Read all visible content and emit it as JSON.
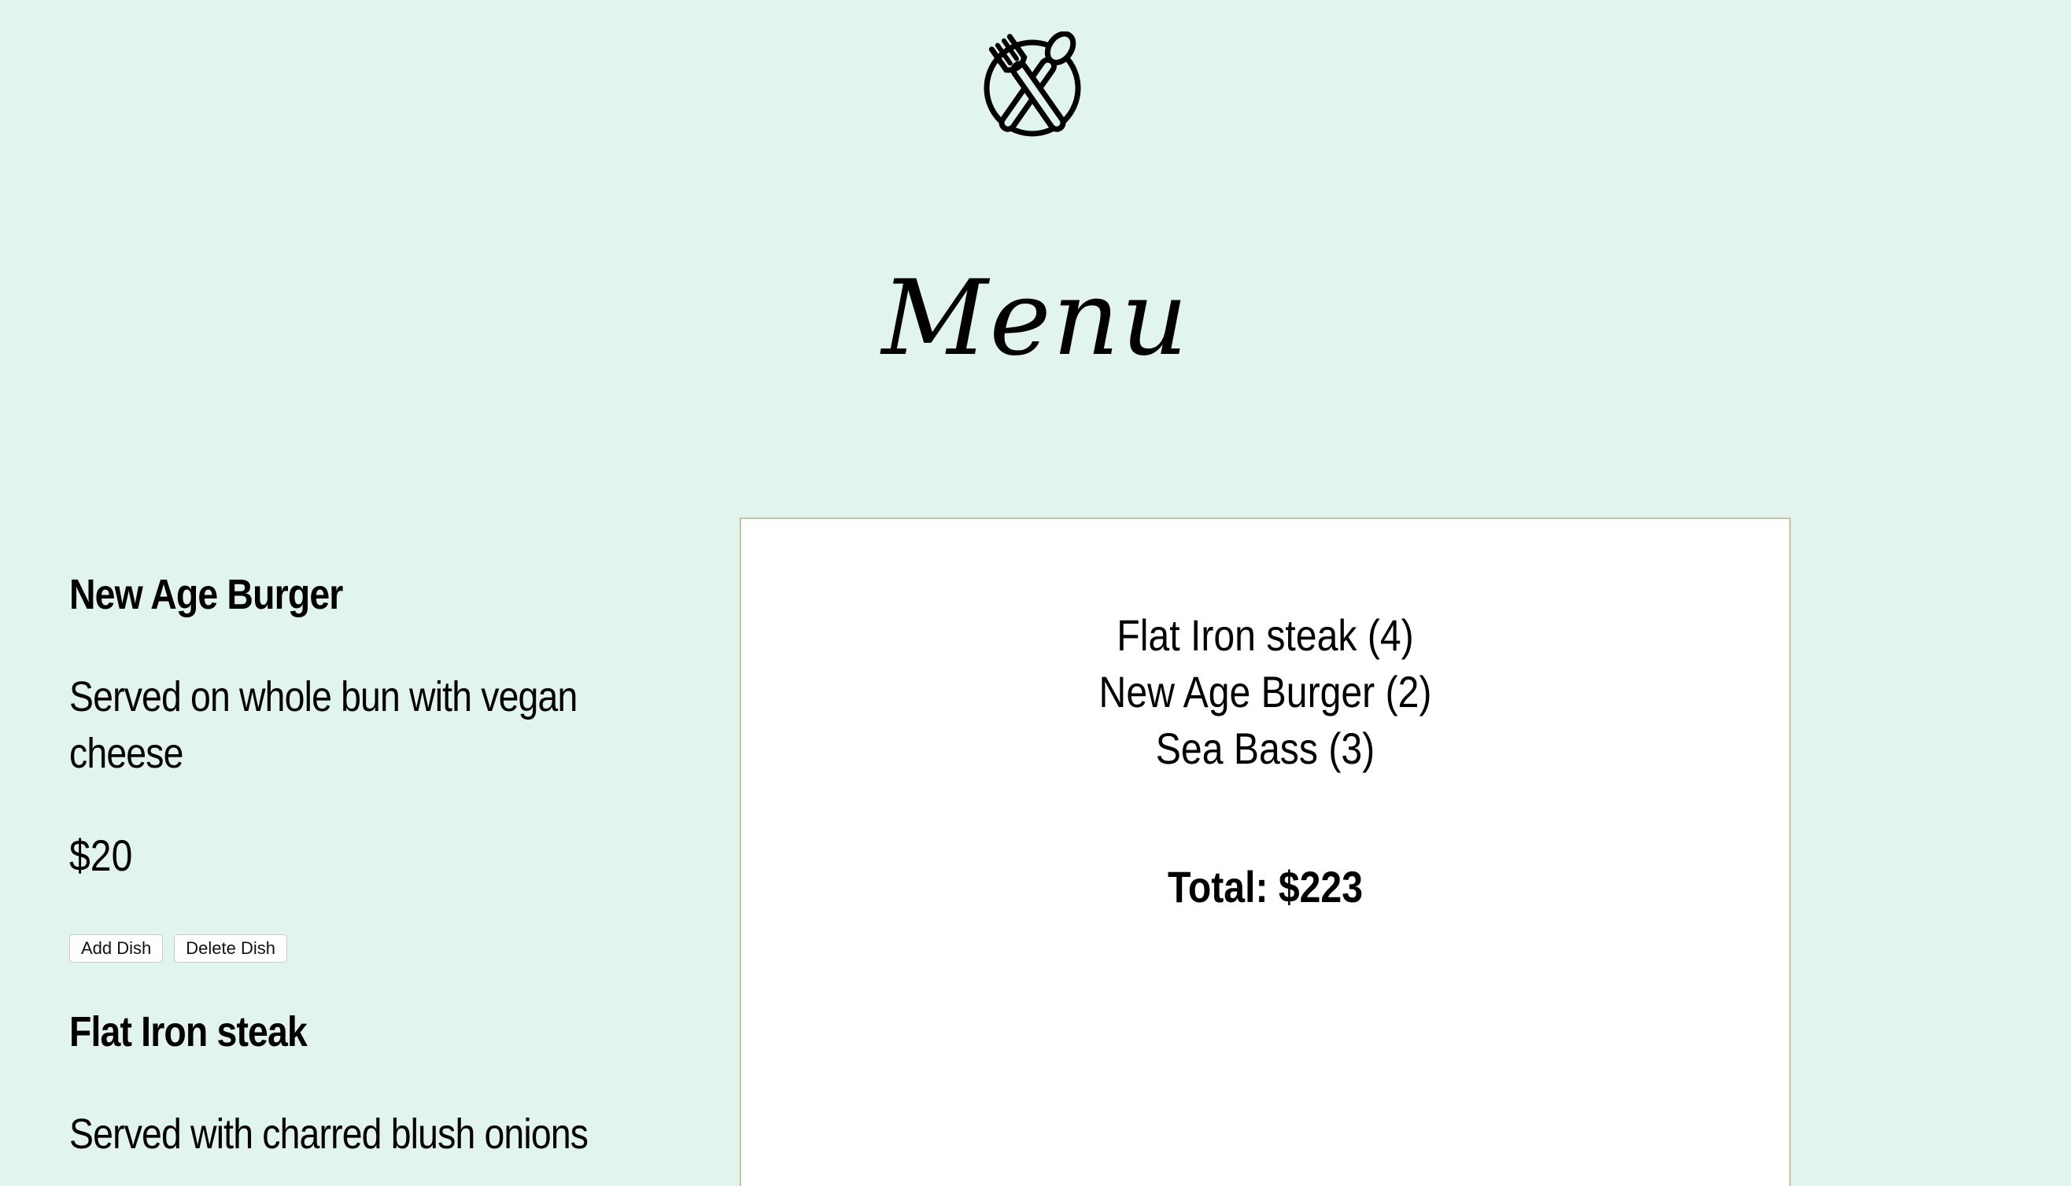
{
  "header": {
    "logo_icon": "fork-spoon-plate-icon",
    "title": "Menu"
  },
  "dishes": [
    {
      "name": "New Age Burger",
      "description": "Served on whole bun with vegan cheese",
      "price": "$20",
      "add_label": "Add Dish",
      "delete_label": "Delete Dish"
    },
    {
      "name": "Flat Iron steak",
      "description": "Served with charred blush onions"
    }
  ],
  "order": {
    "items": [
      "Flat Iron steak (4)",
      "New Age Burger (2)",
      "Sea Bass (3)"
    ],
    "total": "Total: $223"
  },
  "colors": {
    "background": "#e1f5ed",
    "panel": "#ffffff",
    "panel_border": "#c8c0a8"
  }
}
